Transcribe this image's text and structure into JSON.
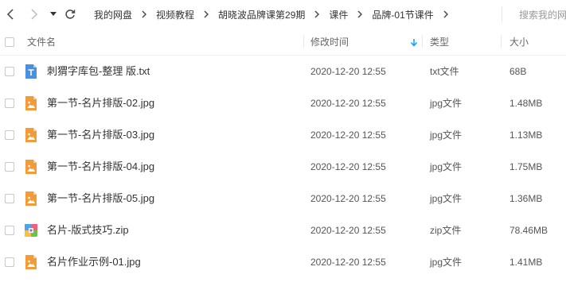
{
  "toolbar": {
    "breadcrumbs": [
      "我的网盘",
      "视频教程",
      "胡晓波品牌课第29期",
      "课件",
      "品牌-01节课件"
    ],
    "search_placeholder": "搜索我的网"
  },
  "table": {
    "headers": {
      "name": "文件名",
      "modified": "修改时间",
      "type": "类型",
      "size": "大小"
    },
    "rows": [
      {
        "name": "刺猬字库包-整理 版.txt",
        "modified": "2020-12-20 12:55",
        "type": "txt文件",
        "size": "68B",
        "icon": "txt-file-icon"
      },
      {
        "name": "第一节-名片排版-02.jpg",
        "modified": "2020-12-20 12:55",
        "type": "jpg文件",
        "size": "1.48MB",
        "icon": "image-file-icon"
      },
      {
        "name": "第一节-名片排版-03.jpg",
        "modified": "2020-12-20 12:55",
        "type": "jpg文件",
        "size": "1.13MB",
        "icon": "image-file-icon"
      },
      {
        "name": "第一节-名片排版-04.jpg",
        "modified": "2020-12-20 12:55",
        "type": "jpg文件",
        "size": "1.75MB",
        "icon": "image-file-icon"
      },
      {
        "name": "第一节-名片排版-05.jpg",
        "modified": "2020-12-20 12:55",
        "type": "jpg文件",
        "size": "1.36MB",
        "icon": "image-file-icon"
      },
      {
        "name": "名片-版式技巧.zip",
        "modified": "2020-12-20 12:55",
        "type": "zip文件",
        "size": "78.46MB",
        "icon": "zip-file-icon"
      },
      {
        "name": "名片作业示例-01.jpg",
        "modified": "2020-12-20 12:55",
        "type": "jpg文件",
        "size": "1.41MB",
        "icon": "image-file-icon"
      }
    ]
  },
  "colors": {
    "accent": "#06a7ff",
    "image_icon": "#f39b3a",
    "txt_icon": "#4a90e2"
  }
}
